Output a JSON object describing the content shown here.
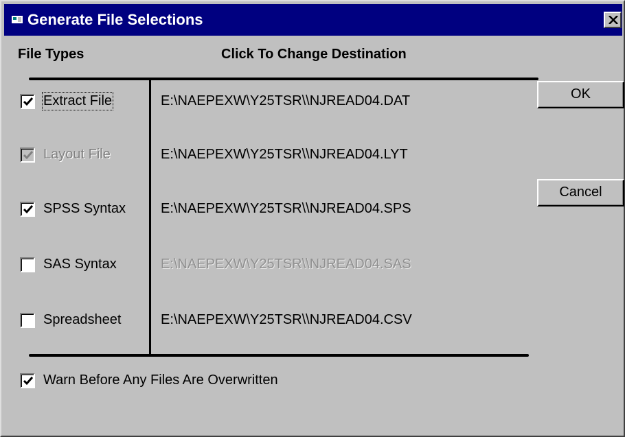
{
  "window": {
    "title": "Generate File Selections",
    "close_label": "close"
  },
  "headers": {
    "file_types": "File Types",
    "destination": "Click To Change Destination"
  },
  "files": [
    {
      "label": "Extract File",
      "checked": true,
      "disabled": false,
      "path": "E:\\NAEPEXW\\Y25TSR\\\\NJREAD04.DAT",
      "path_disabled": false
    },
    {
      "label": "Layout File",
      "checked": true,
      "disabled": true,
      "path": "E:\\NAEPEXW\\Y25TSR\\\\NJREAD04.LYT",
      "path_disabled": false
    },
    {
      "label": "SPSS Syntax",
      "checked": true,
      "disabled": false,
      "path": "E:\\NAEPEXW\\Y25TSR\\\\NJREAD04.SPS",
      "path_disabled": false
    },
    {
      "label": "SAS Syntax",
      "checked": false,
      "disabled": false,
      "path": "E:\\NAEPEXW\\Y25TSR\\\\NJREAD04.SAS",
      "path_disabled": true
    },
    {
      "label": "Spreadsheet",
      "checked": false,
      "disabled": false,
      "path": "E:\\NAEPEXW\\Y25TSR\\\\NJREAD04.CSV",
      "path_disabled": false
    }
  ],
  "warn": {
    "label": "Warn Before Any Files Are Overwritten",
    "checked": true
  },
  "buttons": {
    "ok": "OK",
    "cancel": "Cancel"
  }
}
